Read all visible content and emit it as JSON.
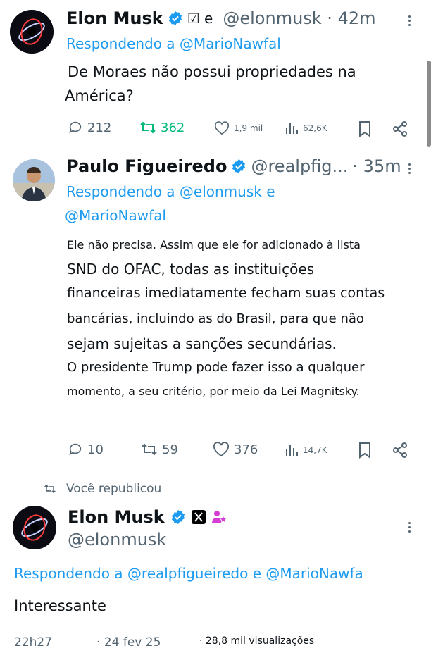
{
  "tweet1": {
    "name": "Elon Musk",
    "badge_suffix": "☑ e",
    "handle_time": "@elonmusk · 42m",
    "reply": "Respondendo a @MarioNawfal",
    "text_line1": "De Moraes não possui propriedades na",
    "text_line2": "América?",
    "replies": "212",
    "reposts": "362",
    "likes": "1,9 mil",
    "views": "62,6K"
  },
  "tweet2": {
    "name": "Paulo Figueiredo",
    "handle": "@realpfig...",
    "time": "· 35m",
    "reply_line1": "Respondendo a @elonmusk e",
    "reply_line2": "@MarioNawfal",
    "lines": [
      "Ele não precisa. Assim que ele for adicionado à lista",
      "SND do OFAC, todas as instituições",
      "financeiras imediatamente fecham suas contas",
      "bancárias, incluindo as do Brasil, para que não",
      "sejam sujeitas a sanções secundárias.",
      "O presidente Trump pode fazer isso a qualquer",
      "momento, a seu critério, por meio da Lei Magnitsky."
    ],
    "replies": "10",
    "reposts": "59",
    "likes": "376",
    "views": "14,7K"
  },
  "repost_banner": "Você republicou",
  "tweet3": {
    "name": "Elon Musk",
    "handle": "@elonmusk",
    "reply": "Respondendo a @realpfigueiredo e @MarioNawfa",
    "text": "Interessante",
    "time": "22h27",
    "date": "· 24 fev 25",
    "views": "· 28,8 mil visualizações"
  },
  "icons": {
    "verified": "verified-badge-icon",
    "reply": "reply-icon",
    "repost": "repost-icon",
    "like": "heart-icon",
    "views": "views-icon",
    "bookmark": "bookmark-icon",
    "share": "share-icon",
    "more": "more-vertical-icon"
  },
  "colors": {
    "accent": "#1d9bf0",
    "repost_active": "#00ba7c",
    "muted": "#536471"
  }
}
